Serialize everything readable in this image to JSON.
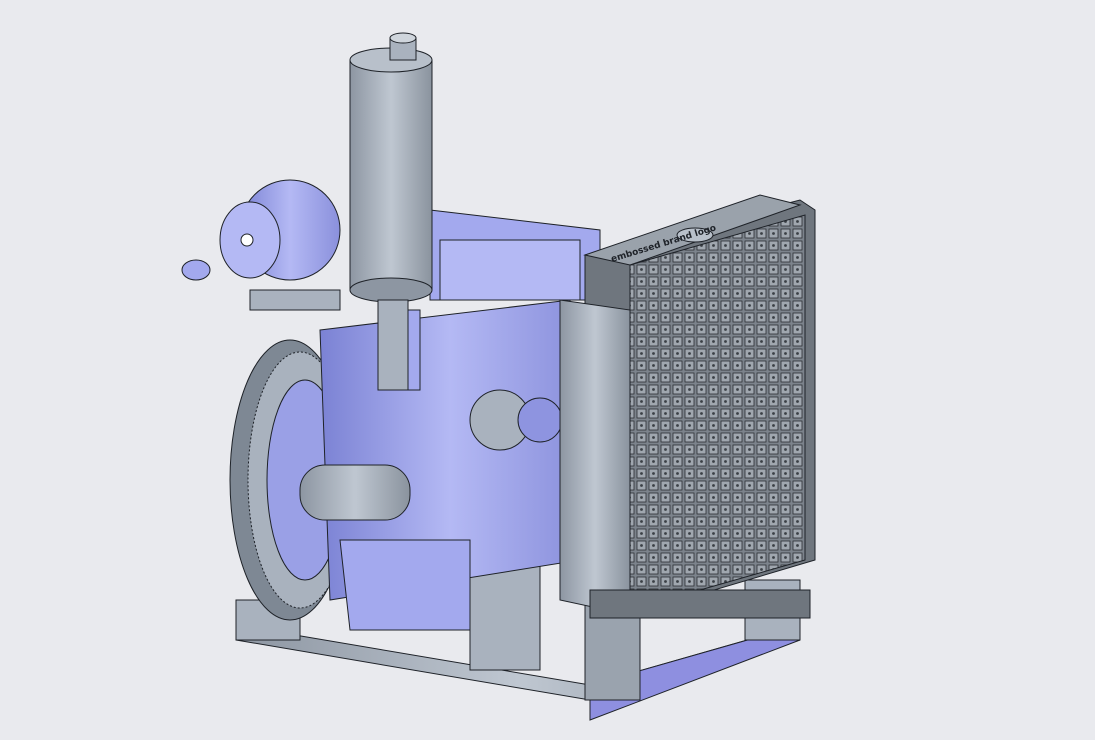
{
  "scene": {
    "background": "#e9eaee",
    "model": "diesel-engine-generator-set",
    "colors": {
      "engine_body": "#a3a9ee",
      "engine_shadow": "#7f86d6",
      "steel": "#a9b2be",
      "steel_dark": "#7e8894",
      "radiator": "#8f969e",
      "outline": "#1e2228"
    },
    "radiator_logo_text": "embossed brand logo"
  }
}
